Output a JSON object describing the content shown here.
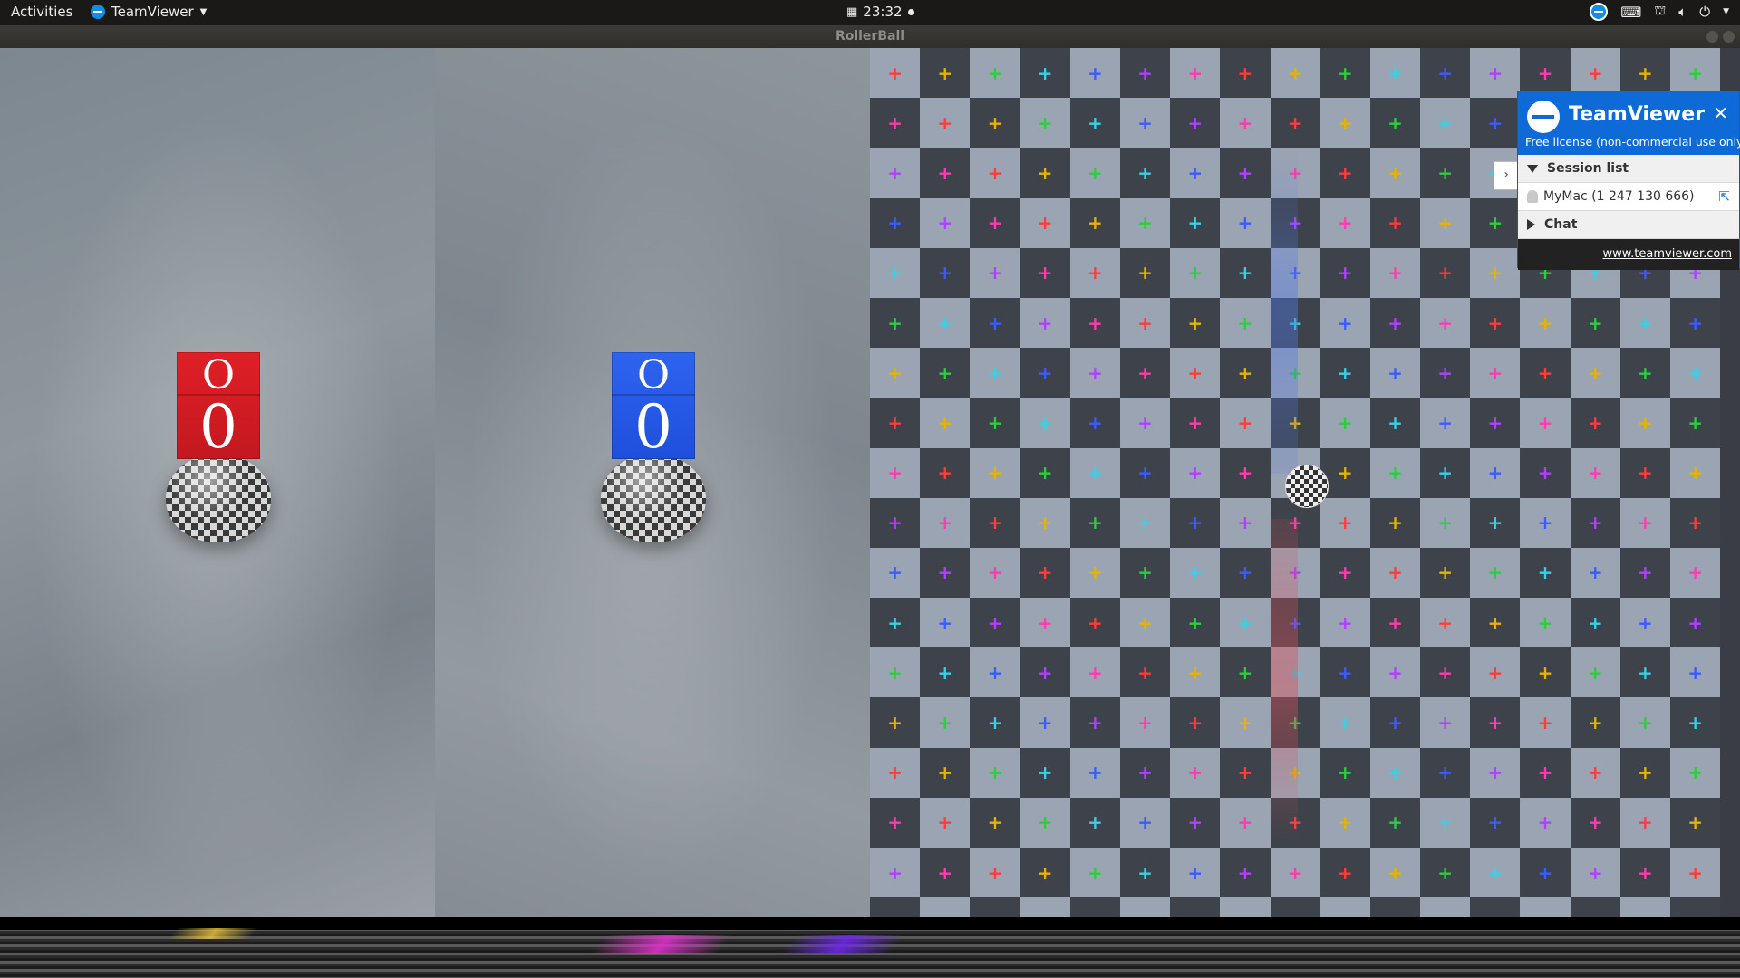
{
  "topbar": {
    "activities": "Activities",
    "app_name": "TeamViewer",
    "app_icon": "teamviewer-icon",
    "clock": "23:32",
    "tray_icons": [
      "teamviewer-tray-icon",
      "keyboard-icon",
      "network-icon",
      "volume-icon",
      "power-icon"
    ]
  },
  "window": {
    "title": "RollerBall"
  },
  "game": {
    "players": [
      {
        "color": "#d41e24",
        "top_letter": "O",
        "score": "0"
      },
      {
        "color": "#2458e8",
        "top_letter": "O",
        "score": "0"
      }
    ],
    "plus_colors": [
      "#ff3b3b",
      "#e6b400",
      "#2ecc40",
      "#39d0e6",
      "#3a5cff",
      "#b040ff",
      "#ff3bb0"
    ]
  },
  "teamviewer": {
    "title": "TeamViewer",
    "license": "Free license (non-commercial use only)",
    "session_list_label": "Session list",
    "session_item": "MyMac (1 247 130 666)",
    "chat_label": "Chat",
    "link": "www.teamviewer.com",
    "tab_glyph": "›"
  }
}
